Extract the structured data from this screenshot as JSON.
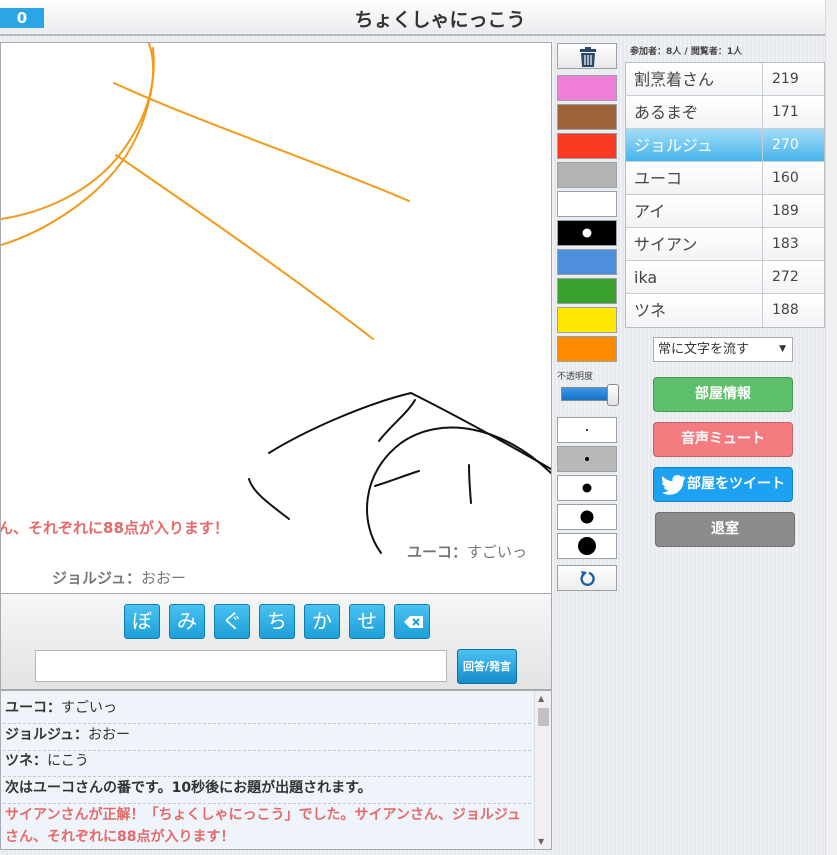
{
  "header": {
    "score": "0",
    "title": "ちょくしゃにっこう"
  },
  "canvas": {
    "scroll_messages": [
      {
        "text": "ん、それぞれに88点が入ります！",
        "style": "red"
      },
      {
        "name": "ユーコ",
        "sep": "：",
        "message": "すごいっ"
      },
      {
        "name": "ジョルジュ",
        "sep": "：",
        "message": "おおー"
      }
    ]
  },
  "palette": {
    "colors": [
      "#f07fdc",
      "#9e633b",
      "#fa3a22",
      "#b3b3b3",
      "#ffffff",
      "#000000",
      "#4d8fdd",
      "#3aa12c",
      "#ffe800",
      "#ff8c00"
    ],
    "selected_index": 5,
    "opacity_label": "不透明度",
    "opacity_value": 1.0,
    "brush_sizes_count": 5,
    "selected_size_index": 1
  },
  "players": {
    "counts": "参加者：8人 / 閲覧者：1人",
    "list": [
      {
        "name": "割烹着さん",
        "score": "219"
      },
      {
        "name": "あるまぞ",
        "score": "171"
      },
      {
        "name": "ジョルジュ",
        "score": "270",
        "current": true
      },
      {
        "name": "ユーコ",
        "score": "160"
      },
      {
        "name": "アイ",
        "score": "189"
      },
      {
        "name": "サイアン",
        "score": "183"
      },
      {
        "name": "ika",
        "score": "272"
      },
      {
        "name": "ツネ",
        "score": "188"
      }
    ]
  },
  "controls": {
    "mode_select": "常に文字を流す",
    "room_info": "部屋情報",
    "mute": "音声ミュート",
    "tweet": "部屋をツイート",
    "leave": "退室"
  },
  "input": {
    "kana": [
      "ぼ",
      "み",
      "ぐ",
      "ち",
      "か",
      "せ"
    ],
    "answer_value": "",
    "submit_label": "回答/発言"
  },
  "chat": [
    {
      "name": "ユーコ",
      "sep": "：",
      "message": "すごいっ"
    },
    {
      "name": "ジョルジュ",
      "sep": "：",
      "message": "おおー"
    },
    {
      "name": "ツネ",
      "sep": "：",
      "message": "にこう"
    },
    {
      "system": "次はユーコさんの番です。10秒後にお題が出題されます。"
    },
    {
      "correct": "サイアンさんが正解！「ちょくしゃにっこう」でした。サイアンさん、ジョルジュさん、それぞれに88点が入ります！"
    }
  ],
  "icons": {
    "trash": "trash-icon",
    "undo": "undo-icon",
    "backspace": "backspace-icon",
    "tweet": "twitter-bird-icon"
  }
}
